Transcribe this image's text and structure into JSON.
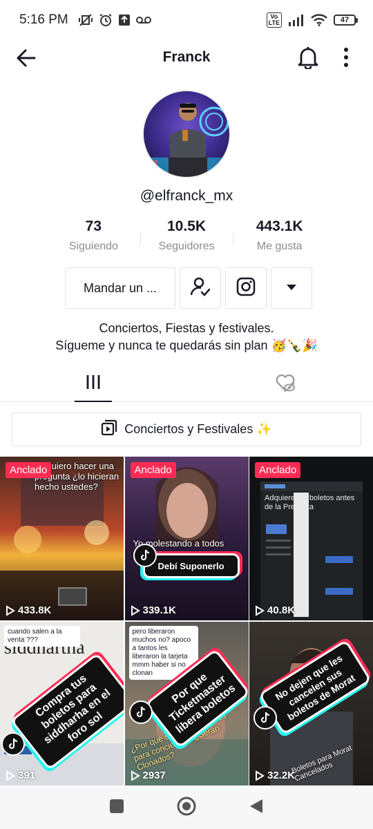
{
  "status_bar": {
    "time": "5:16 PM",
    "battery": "47",
    "network": "VoLTE"
  },
  "header": {
    "title": "Franck"
  },
  "profile": {
    "username": "@elfranck_mx",
    "stats": [
      {
        "value": "73",
        "label": "Siguiendo"
      },
      {
        "value": "10.5K",
        "label": "Seguidores"
      },
      {
        "value": "443.1K",
        "label": "Me gusta"
      }
    ],
    "message_button": "Mandar un ...",
    "bio_line1": "Conciertos, Fiestas y festivales.",
    "bio_line2": "Sígueme y nunca te quedarás sin plan 🥳🍾🎉"
  },
  "playlist": {
    "label": "Conciertos y Festivales ✨"
  },
  "videos": [
    {
      "pinned": "Anclado",
      "views": "433.8K",
      "overlay": "Te quiero hacer una pregunta ¿lo hicieran hecho ustedes?"
    },
    {
      "pinned": "Anclado",
      "views": "339.1K",
      "overlay": "Yo molestando a todos para",
      "caption": "Debí Suponerlo"
    },
    {
      "pinned": "Anclado",
      "views": "40.8K",
      "overlay": "Adquiere tus boletos antes de la Preventa"
    },
    {
      "views": "391",
      "comment": "cuando salen a la venta ???",
      "caption": "Compra tus boletos para siddharha en el foro sol",
      "bg_text": "siddhartha"
    },
    {
      "views": "2937",
      "comment": "pero liberaron muchos no? apoco a tantos les liberaron la tarjeta mmm haber si no clonan",
      "caption": "Por que Ticketmaster libera boletos",
      "overlay": "¿Por qué se liberan boletos para conciertos? ¿Serán Clonados?"
    },
    {
      "views": "32.2K",
      "caption": "No dejen que les cancelen sus boletos de Morat",
      "overlay": "Boletos para Morat Cancelados"
    }
  ],
  "pinned_label": "Anclado",
  "colors": {
    "accent": "#fe2c55",
    "cyan": "#25f4ee",
    "text": "#161823",
    "muted": "#8a8b91"
  },
  "icons": [
    "back-arrow-icon",
    "bell-icon",
    "more-vertical-icon",
    "follow-check-icon",
    "instagram-icon",
    "dropdown-arrow-icon",
    "grid-icon",
    "liked-hidden-icon",
    "playlist-icon",
    "play-icon",
    "square-nav-icon",
    "home-circle-nav-icon",
    "back-triangle-nav-icon"
  ]
}
